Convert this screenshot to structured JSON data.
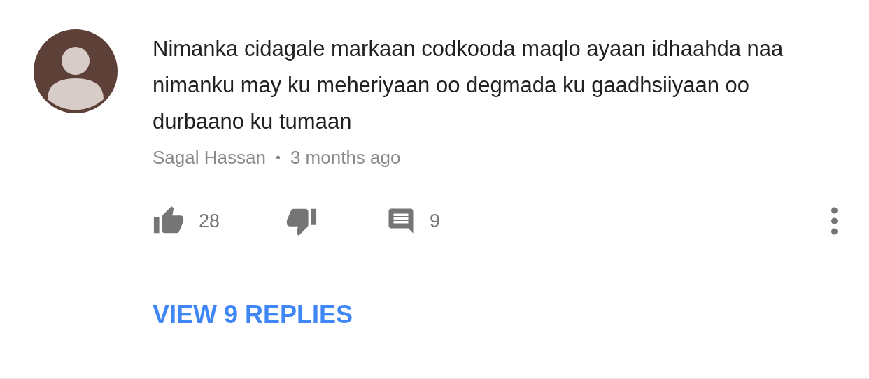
{
  "comment": {
    "text": "Nimanka cidagale markaan codkooda maqlo ayaan idhaahda naa nimanku may ku meheriyaan oo degmada ku gaadhsiiyaan oo durbaano ku tumaan",
    "author": "Sagal Hassan",
    "separator": "•",
    "time": "3 months ago",
    "likes": "28",
    "replies_count": "9"
  },
  "view_replies": "VIEW 9 REPLIES"
}
